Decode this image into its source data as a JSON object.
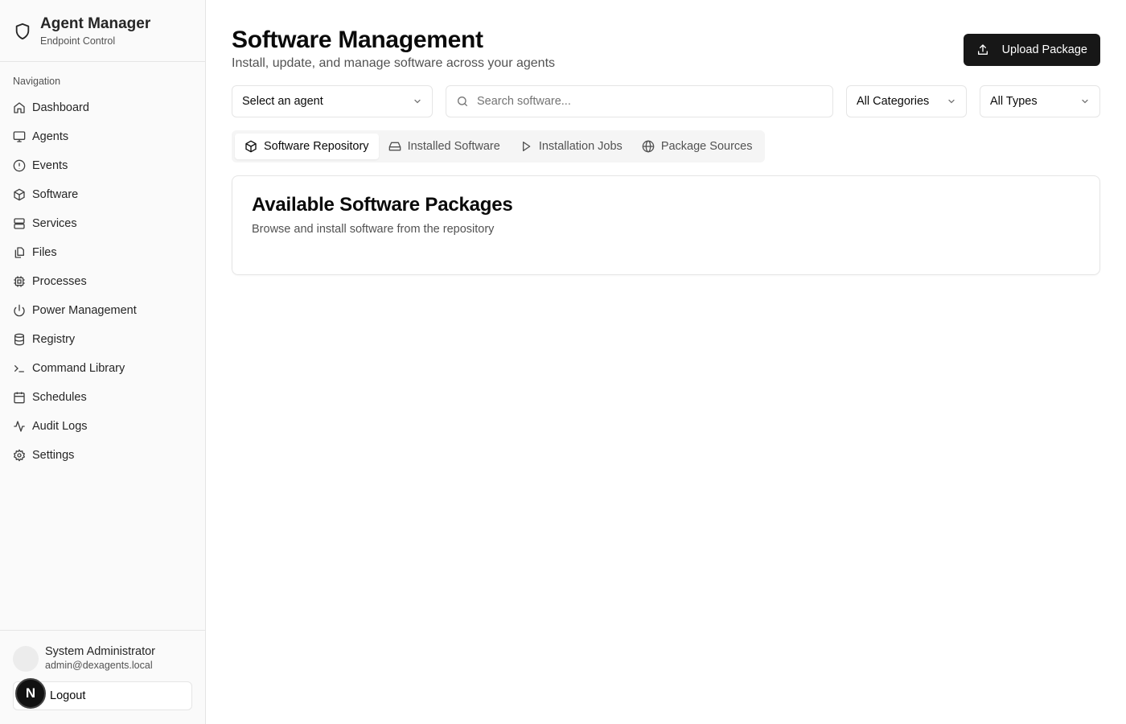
{
  "brand": {
    "title": "Agent Manager",
    "subtitle": "Endpoint Control",
    "icon": "shield-icon"
  },
  "sidebar": {
    "section_label": "Navigation",
    "items": [
      {
        "label": "Dashboard",
        "icon": "home-icon"
      },
      {
        "label": "Agents",
        "icon": "monitor-icon"
      },
      {
        "label": "Events",
        "icon": "alert-circle-icon"
      },
      {
        "label": "Software",
        "icon": "package-icon"
      },
      {
        "label": "Services",
        "icon": "server-icon"
      },
      {
        "label": "Files",
        "icon": "files-icon"
      },
      {
        "label": "Processes",
        "icon": "cpu-icon"
      },
      {
        "label": "Power Management",
        "icon": "power-icon"
      },
      {
        "label": "Registry",
        "icon": "database-icon"
      },
      {
        "label": "Command Library",
        "icon": "terminal-icon"
      },
      {
        "label": "Schedules",
        "icon": "calendar-icon"
      },
      {
        "label": "Audit Logs",
        "icon": "activity-icon"
      },
      {
        "label": "Settings",
        "icon": "gear-icon"
      }
    ]
  },
  "user": {
    "name": "System Administrator",
    "email": "admin@dexagents.local",
    "logout_label": "Logout",
    "badge": "N"
  },
  "header": {
    "title": "Software Management",
    "subtitle": "Install, update, and manage software across your agents",
    "upload_label": "Upload Package"
  },
  "filters": {
    "agent_select": "Select an agent",
    "search_placeholder": "Search software...",
    "category_select": "All Categories",
    "type_select": "All Types"
  },
  "tabs": [
    {
      "label": "Software Repository",
      "icon": "package-icon",
      "active": true
    },
    {
      "label": "Installed Software",
      "icon": "hard-drive-icon",
      "active": false
    },
    {
      "label": "Installation Jobs",
      "icon": "play-icon",
      "active": false
    },
    {
      "label": "Package Sources",
      "icon": "globe-icon",
      "active": false
    }
  ],
  "card": {
    "title": "Available Software Packages",
    "subtitle": "Browse and install software from the repository"
  },
  "colors": {
    "primary": "#171717",
    "border": "#e5e5e5",
    "muted": "#525252",
    "sidebar_bg": "#fafafa"
  }
}
